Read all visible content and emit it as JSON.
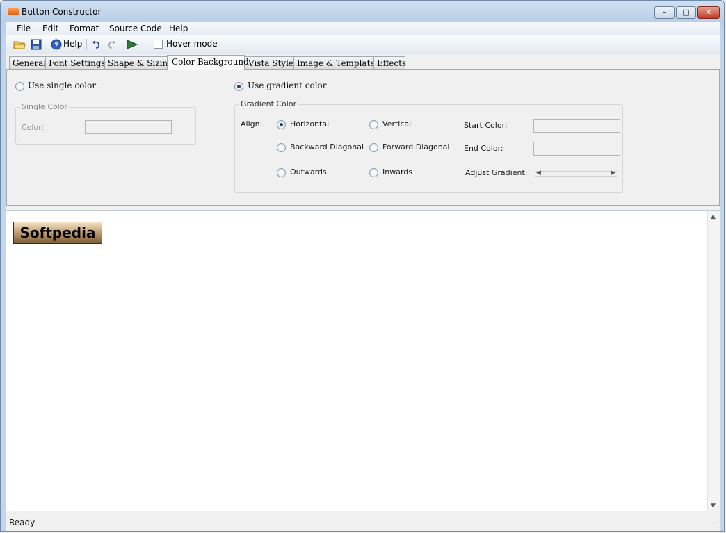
{
  "window": {
    "title": "Button Constructor"
  },
  "menu": [
    "File",
    "Edit",
    "Format",
    "Source Code",
    "Help"
  ],
  "toolbar": {
    "help_label": "Help",
    "hover_mode_label": "Hover mode",
    "hover_mode_checked": false
  },
  "tabs": [
    "General",
    "Font Settings",
    "Shape & Sizing",
    "Color Background",
    "Vista Style",
    "Image & Templates",
    "Effects"
  ],
  "active_tab": "Color Background",
  "color_background": {
    "single_option": "Use single color",
    "gradient_option": "Use gradient color",
    "selected_mode": "gradient",
    "single_group": {
      "title": "Single Color",
      "color_label": "Color:"
    },
    "gradient_group": {
      "title": "Gradient Color",
      "align_label": "Align:",
      "align_options": [
        "Horizontal",
        "Vertical",
        "Backward Diagonal",
        "Forward Diagonal",
        "Outwards",
        "Inwards"
      ],
      "selected_align": "Horizontal",
      "start_color_label": "Start Color:",
      "end_color_label": "End Color:",
      "adjust_label": "Adjust Gradient:"
    }
  },
  "preview": {
    "button_text": "Softpedia"
  },
  "status": {
    "text": "Ready"
  }
}
